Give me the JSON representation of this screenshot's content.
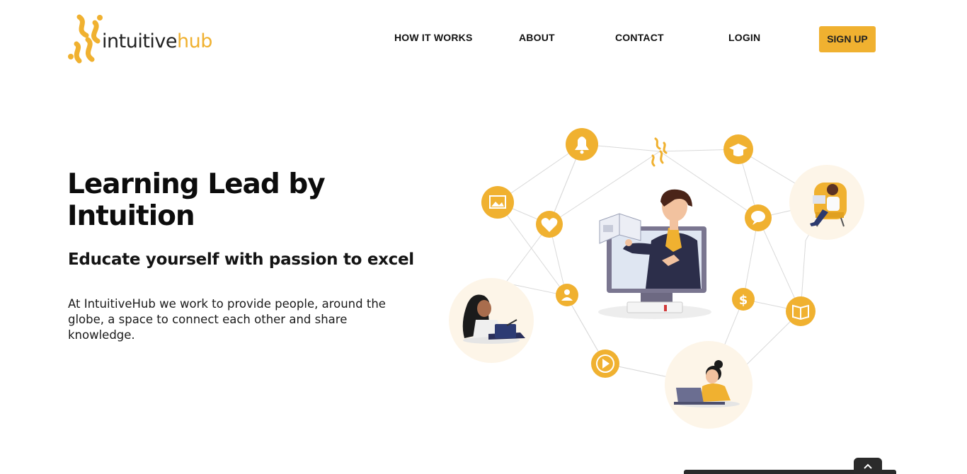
{
  "brand": {
    "name_part1": "intuitive",
    "name_part2": "hub",
    "color": "#f0b130"
  },
  "nav": {
    "how_it_works": "HOW IT WORKS",
    "about": "ABOUT",
    "contact": "CONTACT",
    "login": "LOGIN",
    "signup": "SIGN UP"
  },
  "hero": {
    "title": "Learning Lead by Intuition",
    "subtitle": "Educate yourself with passion to excel",
    "description": "At IntuitiveHub we work to provide people, around the globe, a space to connect each other and share knowledge."
  },
  "illustration_icons": [
    "bell-icon",
    "graduation-cap-icon",
    "image-icon",
    "heart-icon",
    "chat-icon",
    "user-icon",
    "dollar-icon",
    "book-icon",
    "play-icon",
    "logo-icon"
  ],
  "colors": {
    "accent": "#f0b130",
    "text": "#111111",
    "background": "#ffffff"
  }
}
